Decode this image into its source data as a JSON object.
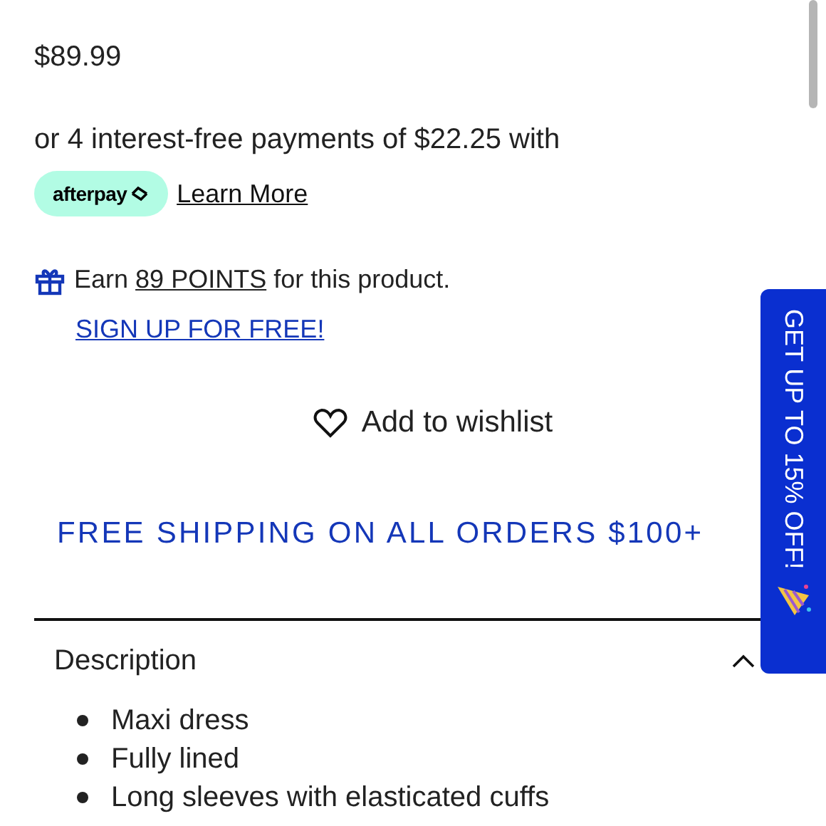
{
  "price": "$89.99",
  "installments": {
    "text": "or 4 interest-free payments of $22.25 with",
    "provider": "afterpay",
    "link": "Learn More"
  },
  "rewards": {
    "before": "Earn",
    "points": "89 POINTS",
    "after": "for this product.",
    "signup": "SIGN UP FOR FREE!"
  },
  "wishlist": "Add to wishlist",
  "shipping_banner": "FREE SHIPPING ON ALL ORDERS $100+",
  "description": {
    "title": "Description",
    "expanded": true,
    "items": [
      "Maxi dress",
      "Fully lined",
      "Long sleeves with elasticated cuffs"
    ]
  },
  "side_tab": "GET UP TO 15% OFF!"
}
